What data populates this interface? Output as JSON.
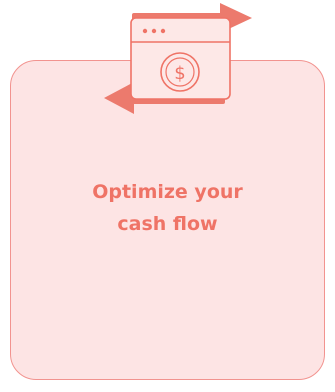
{
  "card": {
    "title_line_1": "Optimize your",
    "title_line_2": "cash flow"
  },
  "icon": {
    "name": "cash-flow-exchange-icon",
    "currency_symbol": "$"
  },
  "colors": {
    "card_background": "#fde4e4",
    "card_border": "#f2938f",
    "accent": "#ef7366",
    "arrow": "#ec7a6d",
    "window_fill": "#fde8e7"
  }
}
